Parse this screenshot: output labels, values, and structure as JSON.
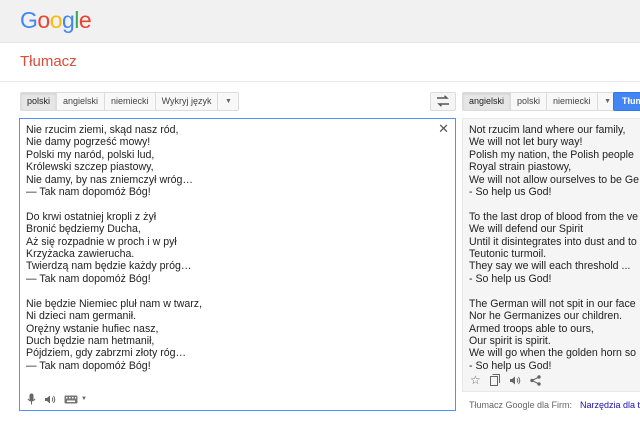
{
  "brand": {
    "logo_letters": [
      {
        "char": "G",
        "color": "#4285f4"
      },
      {
        "char": "o",
        "color": "#ea4335"
      },
      {
        "char": "o",
        "color": "#fbbc05"
      },
      {
        "char": "g",
        "color": "#4285f4"
      },
      {
        "char": "l",
        "color": "#34a853"
      },
      {
        "char": "e",
        "color": "#ea4335"
      }
    ]
  },
  "page_title": "Tłumacz",
  "source_langs": [
    "polski",
    "angielski",
    "niemiecki",
    "Wykryj język"
  ],
  "source_selected": "polski",
  "target_langs": [
    "angielski",
    "polski",
    "niemiecki"
  ],
  "target_selected": "angielski",
  "translate_button": "Tłumacz",
  "source_text": "Nie rzucim ziemi, skąd nasz ród,\nNie damy pogrześć mowy!\nPolski my naród, polski lud,\nKrólewski szczep piastowy,\nNie damy, by nas zniemczył wróg…\n— Tak nam dopomóż Bóg!\n\nDo krwi ostatniej kropli z żył\nBronić będziemy Ducha,\nAż się rozpadnie w proch i w pył\nKrzyżacka zawierucha.\nTwierdzą nam będzie każdy próg…\n— Tak nam dopomóż Bóg!\n\nNie będzie Niemiec pluł nam w twarz,\nNi dzieci nam germanił.\nOrężny wstanie hufiec nasz,\nDuch będzie nam hetmanił,\nPójdziem, gdy zabrzmi złoty róg…\n— Tak nam dopomóż Bóg!",
  "target_text": "Not rzucim land where our family,\nWe will not let bury way!\nPolish my nation, the Polish people\nRoyal strain piastowy,\nWe will not allow ourselves to be Ge\n- So help us God!\n\nTo the last drop of blood from the ve\nWe will defend our Spirit\nUntil it disintegrates into dust and to\nTeutonic turmoil.\nThey say we will each threshold ...\n- So help us God!\n\nThe German will not spit in our face\nNor he Germanizes our children.\nArmed troops able to ours,\nOur spirit is spirit.\nWe will go when the golden horn so\n- So help us God!",
  "footer": {
    "business_label": "Tłumacz Google dla Firm:",
    "tools_link": "Narzędzia dla t"
  },
  "icons": {
    "clear": "close-icon",
    "mic": "microphone-icon",
    "speaker": "speaker-icon",
    "keyboard": "keyboard-icon",
    "star": "star-icon",
    "copy": "copy-icon",
    "share": "share-icon",
    "swap": "swap-icon"
  }
}
